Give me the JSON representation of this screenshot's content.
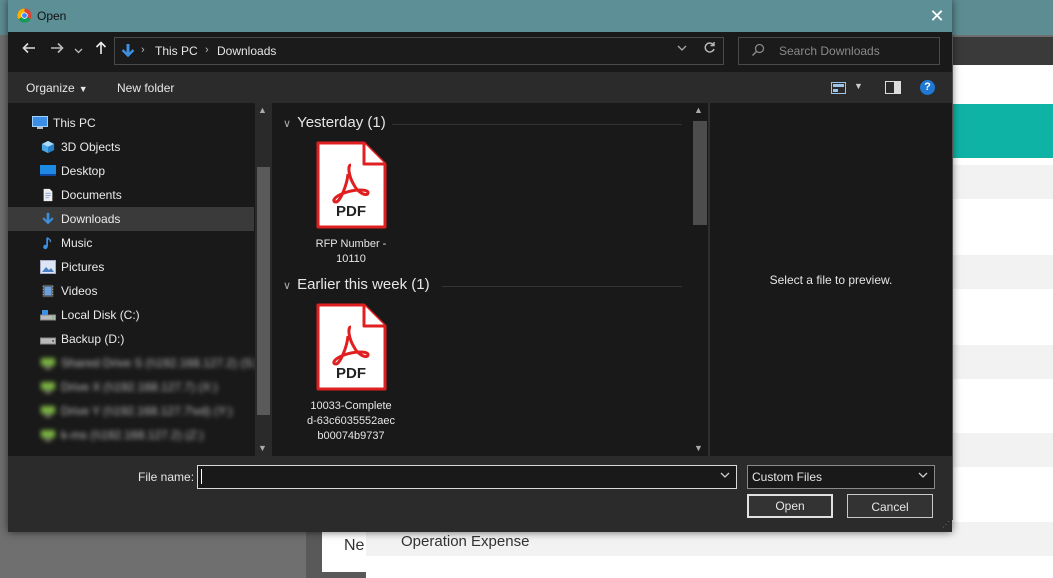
{
  "window": {
    "title": "Open",
    "close_glyph": "✕"
  },
  "nav": {
    "back_icon": "back-arrow-icon",
    "forward_icon": "forward-arrow-icon",
    "recent_icon": "chevron-down-icon",
    "up_icon": "up-arrow-icon",
    "breadcrumb": [
      "This PC",
      "Downloads"
    ]
  },
  "search": {
    "placeholder": "Search Downloads"
  },
  "toolbar": {
    "organize_label": "Organize",
    "new_folder_label": "New folder"
  },
  "sidebar": {
    "items": [
      {
        "label": "This PC",
        "icon": "computer-icon"
      },
      {
        "label": "3D Objects",
        "icon": "cube-icon"
      },
      {
        "label": "Desktop",
        "icon": "desktop-icon"
      },
      {
        "label": "Documents",
        "icon": "document-icon"
      },
      {
        "label": "Downloads",
        "icon": "download-icon",
        "selected": true
      },
      {
        "label": "Music",
        "icon": "music-note-icon"
      },
      {
        "label": "Pictures",
        "icon": "picture-icon"
      },
      {
        "label": "Videos",
        "icon": "video-icon"
      },
      {
        "label": "Local Disk (C:)",
        "icon": "drive-icon"
      },
      {
        "label": "Backup (D:)",
        "icon": "drive-icon"
      },
      {
        "label": "Shared Drive S (\\\\192.168.127.2) (S:)",
        "icon": "network-drive-icon",
        "blurred": true
      },
      {
        "label": "Drive X (\\\\192.168.127.7) (X:)",
        "icon": "network-drive-icon",
        "blurred": true
      },
      {
        "label": "Drive Y (\\\\192.168.127.7\\vd) (Y:)",
        "icon": "network-drive-icon",
        "blurred": true
      },
      {
        "label": "k-ms (\\\\192.168.127.2) (Z:)",
        "icon": "network-drive-icon",
        "blurred": true
      }
    ]
  },
  "groups": [
    {
      "header": "Yesterday (1)",
      "files": [
        {
          "badge": "PDF",
          "name_lines": [
            "RFP Number -",
            "10110"
          ]
        }
      ]
    },
    {
      "header": "Earlier this week (1)",
      "files": [
        {
          "badge": "PDF",
          "name_lines": [
            "10033-Complete",
            "d-63c6035552aec",
            "b00074b9737"
          ]
        }
      ]
    }
  ],
  "preview": {
    "text": "Select a file to preview."
  },
  "footer": {
    "file_name_label": "File name:",
    "file_name_value": "",
    "file_type": "Custom Files",
    "open_label": "Open",
    "cancel_label": "Cancel"
  },
  "background": {
    "item_text": "Operation Expense",
    "partial_text": "Ne"
  },
  "colors": {
    "accent_blue": "#1e78d4",
    "pdf_red": "#e02020",
    "teal": "#0fb3a5",
    "titlebar": "#5d8f96"
  }
}
